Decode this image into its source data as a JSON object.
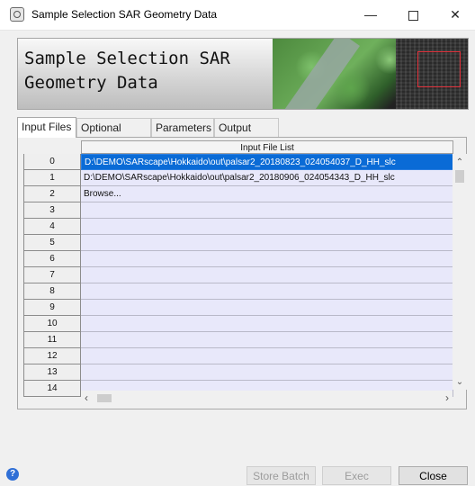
{
  "window": {
    "title": "Sample Selection SAR Geometry Data",
    "minimize": "—",
    "close": "✕"
  },
  "banner": {
    "title": "Sample Selection SAR\nGeometry Data"
  },
  "tabs": [
    {
      "label": "Input Files",
      "active": true
    },
    {
      "label": "Optional Files"
    },
    {
      "label": "Parameters"
    },
    {
      "label": "Output Files"
    }
  ],
  "table": {
    "column_header": "Input File List",
    "rows": [
      {
        "index": "0",
        "value": "D:\\DEMO\\SARscape\\Hokkaido\\out\\palsar2_20180823_024054037_D_HH_slc",
        "selected": true
      },
      {
        "index": "1",
        "value": "D:\\DEMO\\SARscape\\Hokkaido\\out\\palsar2_20180906_024054343_D_HH_slc"
      },
      {
        "index": "2",
        "value": "Browse..."
      },
      {
        "index": "3",
        "value": ""
      },
      {
        "index": "4",
        "value": ""
      },
      {
        "index": "5",
        "value": ""
      },
      {
        "index": "6",
        "value": ""
      },
      {
        "index": "7",
        "value": ""
      },
      {
        "index": "8",
        "value": ""
      },
      {
        "index": "9",
        "value": ""
      },
      {
        "index": "10",
        "value": ""
      },
      {
        "index": "11",
        "value": ""
      },
      {
        "index": "12",
        "value": ""
      },
      {
        "index": "13",
        "value": ""
      },
      {
        "index": "14",
        "value": ""
      }
    ]
  },
  "buttons": {
    "store_batch": "Store Batch",
    "exec": "Exec",
    "close": "Close",
    "help": "?"
  },
  "colors": {
    "selection": "#0a6bd6",
    "cell_bg": "#e8e8fa",
    "help": "#2f6fd6"
  }
}
